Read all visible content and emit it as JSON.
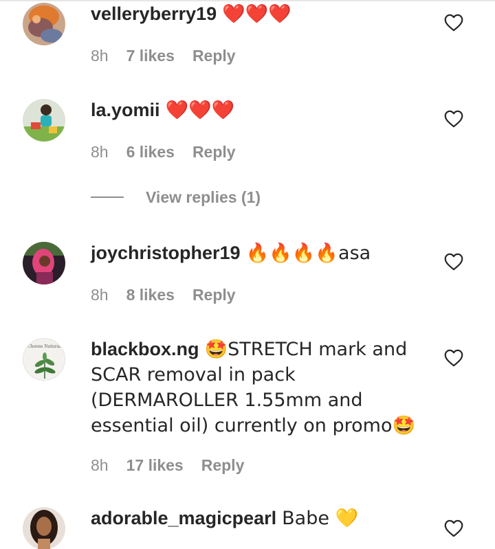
{
  "comments": [
    {
      "username": "velleryberry19",
      "text": "❤️❤️❤️",
      "time": "8h",
      "likes": "7 likes",
      "reply": "Reply",
      "avatar_icon": "avatar-orange-photo"
    },
    {
      "username": "la.yomii",
      "text": "❤️❤️❤️",
      "time": "8h",
      "likes": "6 likes",
      "reply": "Reply",
      "avatar_icon": "avatar-child-photo"
    },
    {
      "username": "joychristopher19",
      "text": "🔥🔥🔥🔥asa",
      "time": "8h",
      "likes": "8 likes",
      "reply": "Reply",
      "avatar_icon": "avatar-pink-hair-photo"
    },
    {
      "username": "blackbox.ng",
      "text": "🤩STRETCH mark and SCAR removal in pack (DERMAROLLER 1.55mm and essential oil) currently on promo🤩",
      "time": "8h",
      "likes": "17 likes",
      "reply": "Reply",
      "avatar_icon": "avatar-choose-natural-plant",
      "avatar_text": "Choose Natural."
    },
    {
      "username": "adorable_magicpearl",
      "text": "Babe 💛",
      "avatar_icon": "avatar-woman-photo"
    }
  ],
  "view_replies": "View replies (1)",
  "colors": {
    "text": "#262626",
    "secondary": "#8e8e8e",
    "heart_red": "#e0203a",
    "background": "#ffffff"
  }
}
